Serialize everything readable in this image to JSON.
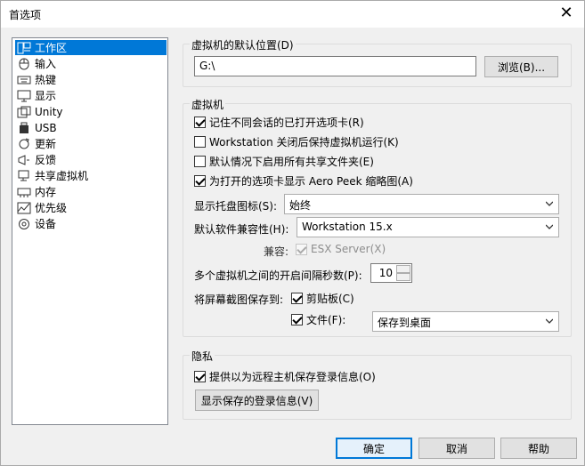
{
  "window": {
    "title": "首选项",
    "close": "✕"
  },
  "nav": {
    "items": [
      {
        "label": "工作区",
        "icon": "workspace-icon"
      },
      {
        "label": "输入",
        "icon": "mouse-icon"
      },
      {
        "label": "热键",
        "icon": "keyboard-icon"
      },
      {
        "label": "显示",
        "icon": "monitor-icon"
      },
      {
        "label": "Unity",
        "icon": "unity-icon"
      },
      {
        "label": "USB",
        "icon": "usb-icon"
      },
      {
        "label": "更新",
        "icon": "update-icon"
      },
      {
        "label": "反馈",
        "icon": "feedback-icon"
      },
      {
        "label": "共享虚拟机",
        "icon": "shared-vm-icon"
      },
      {
        "label": "内存",
        "icon": "memory-icon"
      },
      {
        "label": "优先级",
        "icon": "priority-icon"
      },
      {
        "label": "设备",
        "icon": "device-icon"
      }
    ]
  },
  "default_location": {
    "legend": "虚拟机的默认位置(D)",
    "path": "G:\\",
    "browse": "浏览(B)..."
  },
  "vm": {
    "legend": "虚拟机",
    "remember_tabs": "记住不同会话的已打开选项卡(R)",
    "keep_running": "Workstation 关闭后保持虚拟机运行(K)",
    "enable_shared": "默认情况下启用所有共享文件夹(E)",
    "aero_peek": "为打开的选项卡显示 Aero Peek 缩略图(A)",
    "tray_label": "显示托盘图标(S):",
    "tray_value": "始终",
    "compat_label": "默认软件兼容性(H):",
    "compat_value": "Workstation 15.x",
    "compatible_label": "兼容:",
    "esx": "ESX Server(X)",
    "delay_label": "多个虚拟机之间的开启间隔秒数(P):",
    "delay_value": "10",
    "screenshot_label": "将屏幕截图保存到:",
    "clipboard": "剪贴板(C)",
    "file": "文件(F):",
    "file_value": "保存到桌面"
  },
  "privacy": {
    "legend": "隐私",
    "save_login": "提供以为远程主机保存登录信息(O)",
    "show_saved": "显示保存的登录信息(V)"
  },
  "footer": {
    "ok": "确定",
    "cancel": "取消",
    "help": "帮助"
  }
}
